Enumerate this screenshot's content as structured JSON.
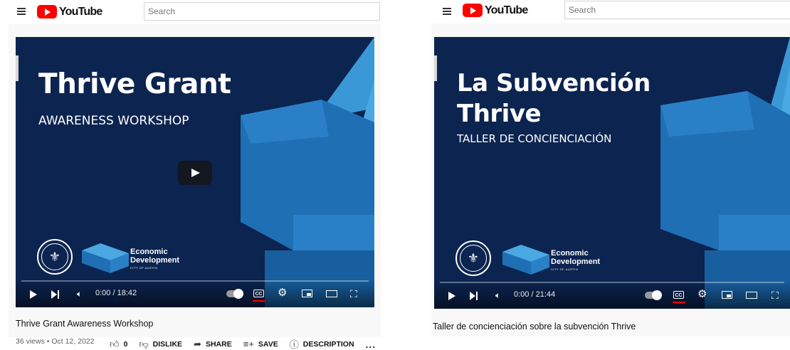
{
  "shared": {
    "logo_text": "YouTube",
    "search_placeholder": "Search",
    "brand_line1": "Economic",
    "brand_line2": "Development",
    "brand_line3": "CITY OF AUSTIN"
  },
  "left": {
    "slide_title": "Thrive Grant",
    "slide_subtitle": "AWARENESS WORKSHOP",
    "time_display": "0:00 / 18:42",
    "video_title": "Thrive Grant Awareness Workshop",
    "meta": "36 views • Oct 12, 2022",
    "like_count": "0",
    "dislike_label": "DISLIKE",
    "share_label": "SHARE",
    "save_label": "SAVE",
    "description_label": "DESCRIPTION",
    "more_label": "..."
  },
  "right": {
    "slide_title": "La Subvención Thrive",
    "slide_subtitle": "TALLER DE CONCIENCIACIÓN",
    "time_display": "0:00 / 21:44",
    "video_title": "Taller de concienciación sobre la subvención Thrive"
  },
  "colors": {
    "slide_bg": "#0c2450",
    "accent_red": "#ff0000",
    "shape_light": "#2f8fd0",
    "shape_mid": "#1f6fb5",
    "shape_dark": "#175f9f"
  },
  "icons": [
    "menu-icon",
    "youtube-logo-icon",
    "play-icon",
    "next-icon",
    "volume-icon",
    "autoplay-toggle-icon",
    "captions-icon",
    "settings-gear-icon",
    "miniplayer-icon",
    "theater-icon",
    "fullscreen-icon",
    "like-icon",
    "dislike-icon",
    "share-icon",
    "save-icon",
    "info-icon"
  ]
}
